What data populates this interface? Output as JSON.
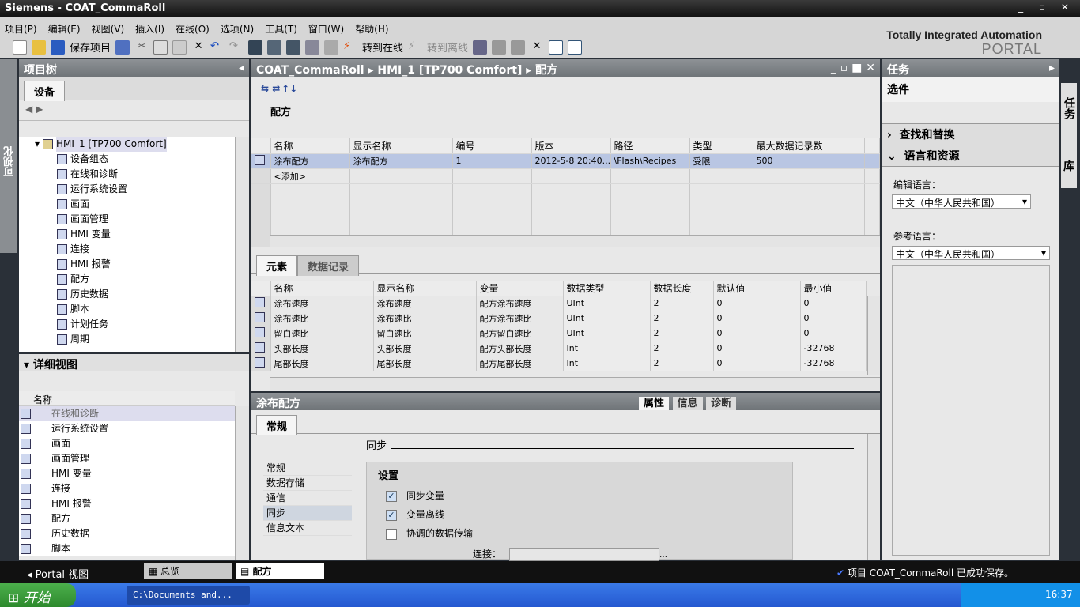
{
  "window": {
    "title": "Siemens  -  COAT_CommaRoll",
    "controls": "_ ▫ ✕"
  },
  "menu": [
    "项目(P)",
    "编辑(E)",
    "视图(V)",
    "插入(I)",
    "在线(O)",
    "选项(N)",
    "工具(T)",
    "窗口(W)",
    "帮助(H)"
  ],
  "toolbar": {
    "save_project": "保存项目",
    "go_online": "转到在线",
    "go_offline": "转到离线"
  },
  "brand": {
    "line1": "Totally Integrated Automation",
    "line2": "PORTAL"
  },
  "left_strip": "可视化",
  "project_tree": {
    "title": "项目树",
    "tab": "设备",
    "root": "HMI_1 [TP700 Comfort]",
    "items": [
      "设备组态",
      "在线和诊断",
      "运行系统设置",
      "画面",
      "画面管理",
      "HMI 变量",
      "连接",
      "HMI 报警",
      "配方",
      "历史数据",
      "脚本",
      "计划任务",
      "周期"
    ]
  },
  "detail_view": {
    "title": "详细视图",
    "column": "名称",
    "items": [
      "在线和诊断",
      "运行系统设置",
      "画面",
      "画面管理",
      "HMI 变量",
      "连接",
      "HMI 报警",
      "配方",
      "历史数据",
      "脚本"
    ]
  },
  "editor": {
    "breadcrumb": [
      "COAT_CommaRoll",
      "HMI_1 [TP700 Comfort]",
      "配方"
    ],
    "section": "配方",
    "recipe_cols": [
      "名称",
      "显示名称",
      "编号",
      "版本",
      "路径",
      "类型",
      "最大数据记录数"
    ],
    "recipe_rows": [
      [
        "涂布配方",
        "涂布配方",
        "1",
        "2012-5-8 20:40...",
        "\\Flash\\Recipes",
        "受限",
        "500"
      ]
    ],
    "add_label": "<添加>",
    "tabs": [
      "元素",
      "数据记录"
    ],
    "elem_cols": [
      "名称",
      "显示名称",
      "变量",
      "数据类型",
      "数据长度",
      "默认值",
      "最小值"
    ],
    "elem_rows": [
      [
        "涂布速度",
        "涂布速度",
        "配方涂布速度",
        "UInt",
        "2",
        "0",
        "0"
      ],
      [
        "涂布速比",
        "涂布速比",
        "配方涂布速比",
        "UInt",
        "2",
        "0",
        "0"
      ],
      [
        "留白速比",
        "留白速比",
        "配方留白速比",
        "UInt",
        "2",
        "0",
        "0"
      ],
      [
        "头部长度",
        "头部长度",
        "配方头部长度",
        "Int",
        "2",
        "0",
        "-32768"
      ],
      [
        "尾部长度",
        "尾部长度",
        "配方尾部长度",
        "Int",
        "2",
        "0",
        "-32768"
      ]
    ]
  },
  "properties": {
    "title": "涂布配方",
    "tabs": [
      "属性",
      "信息",
      "诊断"
    ],
    "subtab": "常规",
    "nav": [
      "常规",
      "数据存储",
      "通信",
      "同步",
      "信息文本"
    ],
    "section": "同步",
    "group": "设置",
    "checks": [
      {
        "label": "同步变量",
        "checked": true
      },
      {
        "label": "变量离线",
        "checked": true
      },
      {
        "label": "协调的数据传输",
        "checked": false
      }
    ],
    "connection_label": "连接："
  },
  "tasks": {
    "title": "任务",
    "options": "选件",
    "find_replace": "查找和替换",
    "lang_res": "语言和资源",
    "edit_lang_label": "编辑语言：",
    "edit_lang": "中文（中华人民共和国）",
    "ref_lang_label": "参考语言：",
    "ref_lang": "中文（中华人民共和国）",
    "side_tabs": [
      "任务",
      "库"
    ]
  },
  "status": {
    "portal": "Portal 视图",
    "tabs": [
      "总览",
      "配方"
    ],
    "message": "项目 COAT_CommaRoll 已成功保存。"
  },
  "taskbar": {
    "start": "开始",
    "task": "C:\\Documents and...",
    "clock": "16:37"
  }
}
